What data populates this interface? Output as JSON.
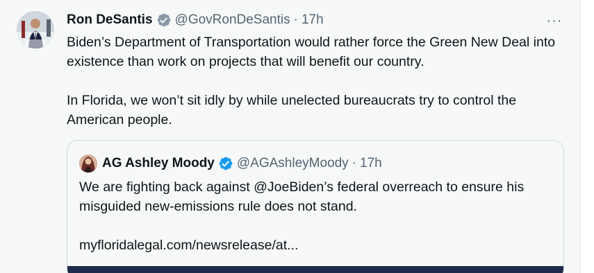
{
  "tweet": {
    "author_name": "Ron DeSantis",
    "author_handle": "@GovRonDeSantis",
    "separator": "·",
    "time": "17h",
    "more_label": "···",
    "paragraphs": [
      "Biden’s Department of Transportation would rather force the Green New Deal into existence than work on projects that will benefit our country.",
      "In Florida, we won’t sit idly by while unelected bureaucrats try to control the American people."
    ]
  },
  "quote": {
    "author_name": "AG Ashley Moody",
    "author_handle": "@AGAshleyMoody",
    "separator": "·",
    "time": "17h",
    "text": "We are fighting back against @JoeBiden’s federal overreach to ensure his misguided new-emissions rule does not stand.",
    "link": "myfloridalegal.com/newsrelease/at..."
  },
  "colors": {
    "verified_blue": "#1d9bf0",
    "secondary_text": "#536471",
    "primary_text": "#0f1419",
    "card_background": "#f7f9f9"
  }
}
